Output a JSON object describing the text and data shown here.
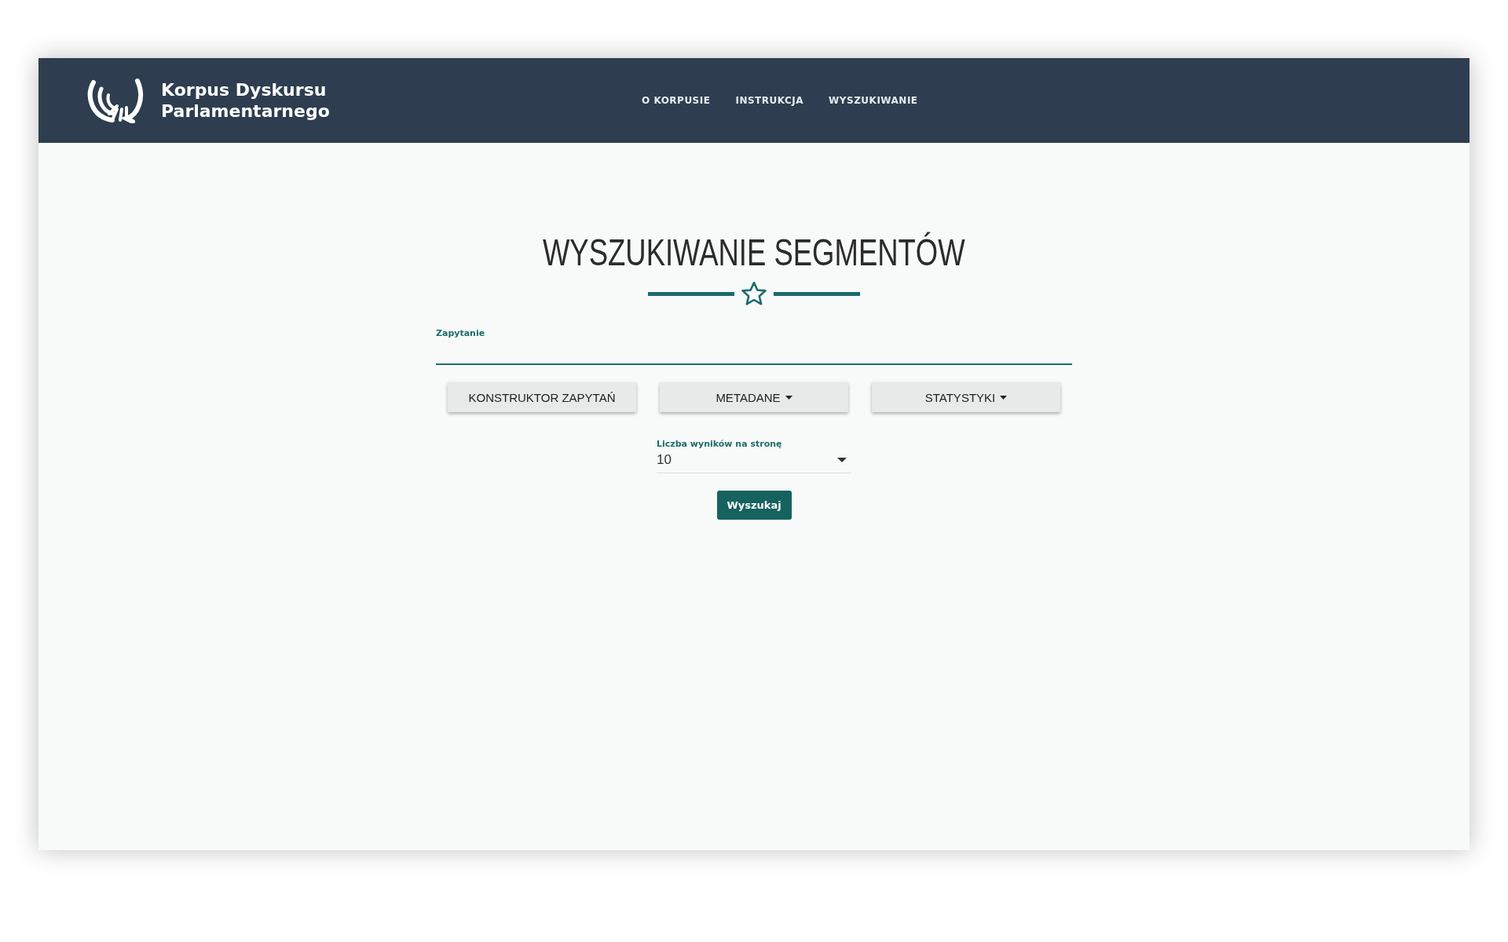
{
  "header": {
    "logo_text": [
      "Korpus Dyskursu",
      "Parlamentarnego"
    ],
    "nav": [
      {
        "label": "O KORPUSIE"
      },
      {
        "label": "INSTRUKCJA"
      },
      {
        "label": "WYSZUKIWANIE"
      }
    ]
  },
  "page": {
    "title": "WYSZUKIWANIE SEGMENTÓW"
  },
  "query_field": {
    "label": "Zapytanie"
  },
  "buttons": [
    {
      "label": "KONSTRUKTOR ZAPYTAŃ",
      "dropdown": false
    },
    {
      "label": "METADANE",
      "dropdown": true
    },
    {
      "label": "STATYSTYKI",
      "dropdown": true
    }
  ],
  "results_per_page": {
    "label": "Liczba wyników na stronę",
    "value": "10"
  },
  "search_button": {
    "label": "Wyszukaj"
  }
}
